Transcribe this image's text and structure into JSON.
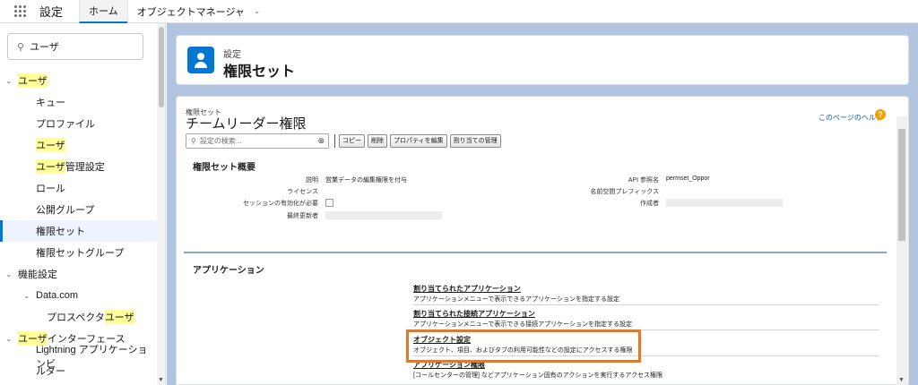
{
  "topbar": {
    "app_name": "設定",
    "tabs": [
      {
        "label": "ホーム"
      },
      {
        "label": "オブジェクトマネージャ"
      }
    ]
  },
  "sidebar": {
    "search_value": "ユーザ",
    "items": [
      {
        "label": "ユーザ",
        "caret": "⌄",
        "highlighted": true,
        "indent": 0
      },
      {
        "label": "キュー",
        "indent": 1
      },
      {
        "label": "プロファイル",
        "indent": 1
      },
      {
        "label": "ユーザ",
        "indent": 1,
        "highlighted": true
      },
      {
        "label_hl": "ユーザ",
        "label_rest": "管理設定",
        "indent": 1
      },
      {
        "label": "ロール",
        "indent": 1
      },
      {
        "label": "公開グループ",
        "indent": 1
      },
      {
        "label": "権限セット",
        "indent": 1,
        "selected": true
      },
      {
        "label": "権限セットグループ",
        "indent": 1
      },
      {
        "label": "機能設定",
        "caret": "⌄",
        "indent": 0
      },
      {
        "label": "Data.com",
        "caret": "⌄",
        "indent": 1
      },
      {
        "label_rest_pre": "プロスペクタ",
        "label_hl": "ユーザ",
        "indent": 2
      },
      {
        "label_hl": "ユーザ",
        "label_rest": "インターフェース",
        "caret": "⌄",
        "indent": 0
      },
      {
        "label": "Lightning アプリケーションビ",
        "indent": 1
      },
      {
        "label": "ルダー",
        "indent": 1
      }
    ]
  },
  "header": {
    "small_label": "設定",
    "title": "権限セット"
  },
  "permset": {
    "small_label": "権限セット",
    "name": "チームリーダー権限",
    "help_link": "このページのヘルプ",
    "help_icon": "?",
    "search_placeholder": "設定の検索...",
    "buttons": [
      "コピー",
      "削除",
      "プロパティを編集",
      "割り当ての管理"
    ]
  },
  "overview": {
    "title": "権限セット概要",
    "fields": {
      "description_label": "説明",
      "description_value": "営業データの編集権限を付与",
      "license_label": "ライセンス",
      "session_label": "セッションの有効化が必要",
      "last_modified_label": "最終更新者",
      "api_label": "API 参照名",
      "api_value": "permset_Oppor",
      "namespace_label": "名前空間プレフィックス",
      "creator_label": "作成者"
    }
  },
  "apps": {
    "title": "アプリケーション",
    "items": [
      {
        "title": "割り当てられたアプリケーション",
        "desc": "アプリケーションメニューで表示できるアプリケーションを指定する設定"
      },
      {
        "title": "割り当てられた接続アプリケーション",
        "desc": "アプリケーションメニューで表示できる接続アプリケーションを指定する設定"
      },
      {
        "title": "オブジェクト設定",
        "desc": "オブジェクト、項目、およびタブの利用可能性などの設定にアクセスする権限"
      },
      {
        "title": "アプリケーション権限",
        "desc": "[コールセンターの管理] などアプリケーション固有のアクションを実行するアクセス権限"
      }
    ]
  },
  "colors": {
    "brand": "#0176d3",
    "highlight": "#ffff99",
    "callout": "#e87722",
    "background": "#b0c4df"
  },
  "icons": [
    "app-launcher-icon",
    "chevron-down-icon",
    "search-icon",
    "user-icon",
    "help-icon",
    "clear-icon"
  ]
}
